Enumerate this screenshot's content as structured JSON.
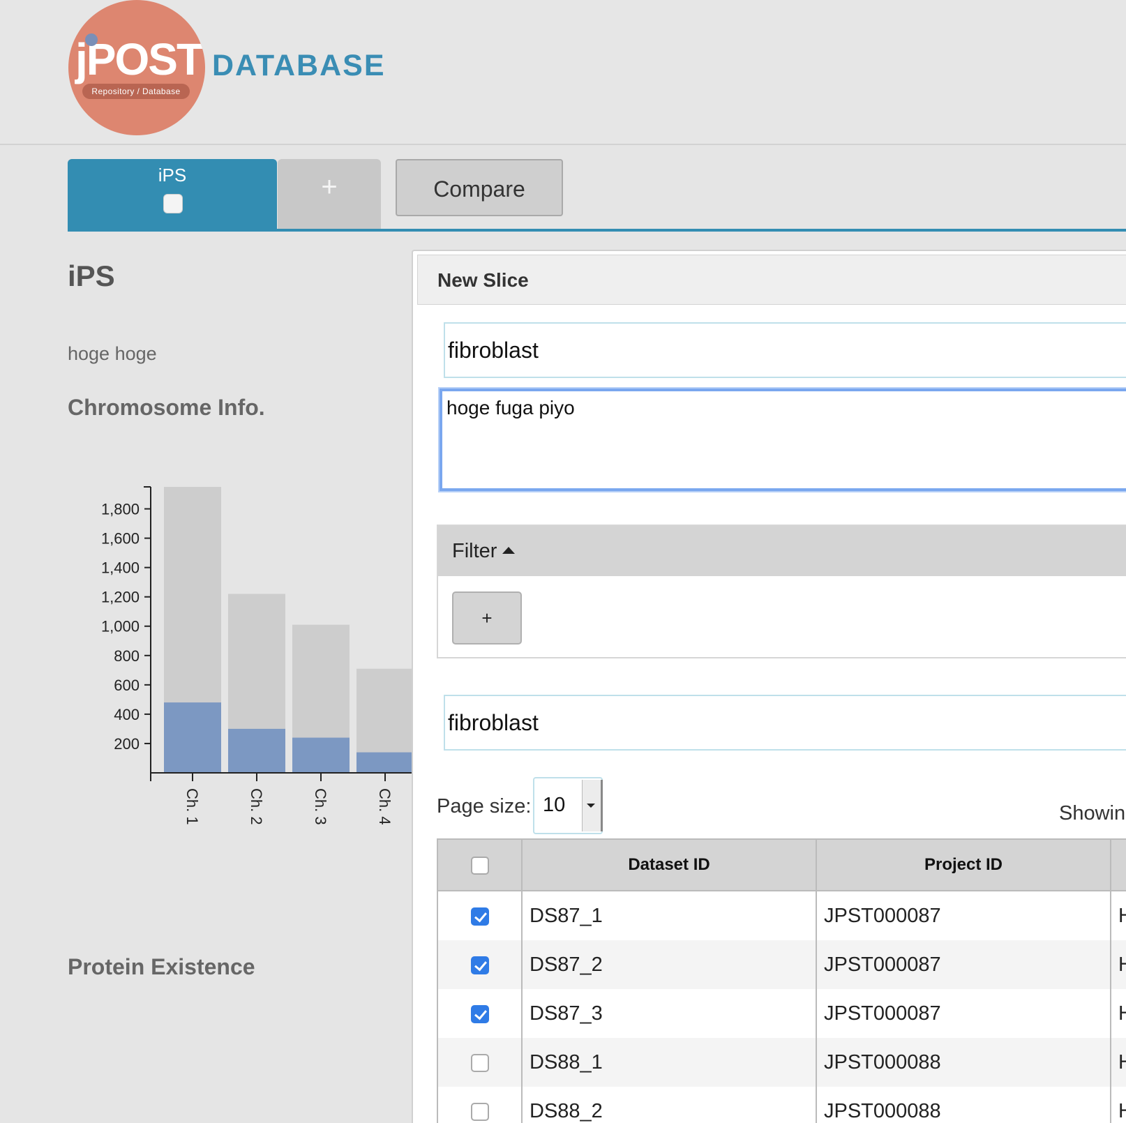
{
  "header": {
    "logo_word": "jPOST",
    "logo_sub": "Repository / Database",
    "title": "DATABASE"
  },
  "tabs": {
    "active_label": "iPS",
    "add_label": "+",
    "compare_label": "Compare"
  },
  "left": {
    "title": "iPS",
    "description": "hoge hoge",
    "chromosome_heading": "Chromosome Info.",
    "protein_existence_heading": "Protein Existence"
  },
  "panel": {
    "title": "New Slice",
    "name_value": "fibroblast",
    "description_value": "hoge fuga piyo",
    "filter_label": "Filter",
    "filter_add_label": "+",
    "search_value": "fibroblast",
    "page_size_label": "Page size:",
    "page_size_value": "10",
    "showing_text": "Showing"
  },
  "table": {
    "columns": [
      "Dataset ID",
      "Project ID"
    ],
    "rows": [
      {
        "checked": true,
        "dataset_id": "DS87_1",
        "project_id": "JPST000087",
        "extra": "H"
      },
      {
        "checked": true,
        "dataset_id": "DS87_2",
        "project_id": "JPST000087",
        "extra": "H"
      },
      {
        "checked": true,
        "dataset_id": "DS87_3",
        "project_id": "JPST000087",
        "extra": "H"
      },
      {
        "checked": false,
        "dataset_id": "DS88_1",
        "project_id": "JPST000088",
        "extra": "H"
      },
      {
        "checked": false,
        "dataset_id": "DS88_2",
        "project_id": "JPST000088",
        "extra": "H"
      }
    ]
  },
  "chart_data": {
    "type": "bar",
    "categories": [
      "Ch. 1",
      "Ch. 2",
      "Ch. 3",
      "Ch. 4"
    ],
    "series": [
      {
        "values": [
          1950,
          1220,
          1010,
          710
        ],
        "color": "#cdcdcd"
      },
      {
        "values": [
          480,
          300,
          240,
          140
        ],
        "color": "#7c98c2"
      }
    ],
    "yticks": [
      200,
      400,
      600,
      800,
      1000,
      1200,
      1400,
      1600,
      1800
    ],
    "ytick_labels": [
      "200",
      "400",
      "600",
      "800",
      "1,000",
      "1,200",
      "1,400",
      "1,600",
      "1,800"
    ],
    "ylim": [
      0,
      1950
    ],
    "grid": false
  }
}
